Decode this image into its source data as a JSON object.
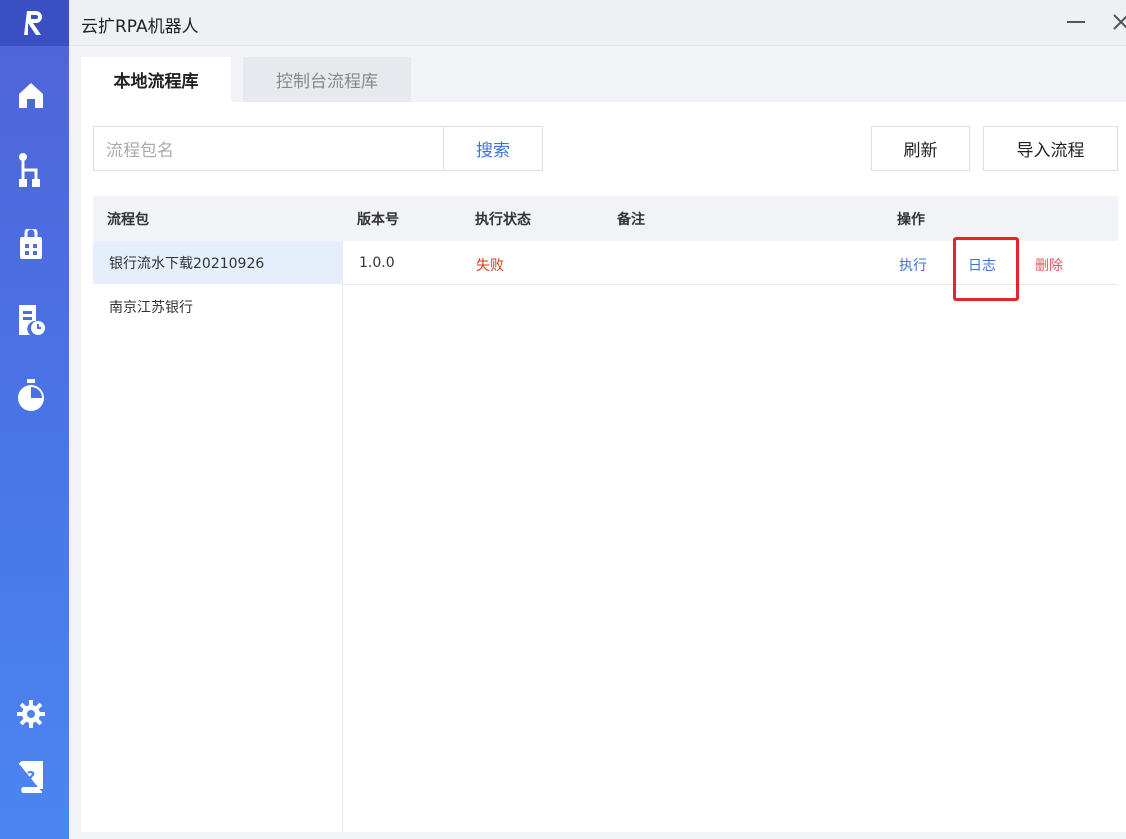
{
  "app": {
    "title": "云扩RPA机器人"
  },
  "tabs": [
    {
      "label": "本地流程库",
      "active": true
    },
    {
      "label": "控制台流程库",
      "active": false
    }
  ],
  "toolbar": {
    "search_placeholder": "流程包名",
    "search_label": "搜索",
    "refresh_label": "刷新",
    "import_label": "导入流程"
  },
  "table": {
    "headers": {
      "package": "流程包",
      "version": "版本号",
      "status": "执行状态",
      "notes": "备注",
      "actions": "操作"
    },
    "packages": [
      "银行流水下载20210926",
      "南京江苏银行"
    ],
    "rows": [
      {
        "version": "1.0.0",
        "status": "失败",
        "notes": "",
        "run": "执行",
        "log": "日志",
        "delete": "删除"
      }
    ]
  },
  "colors": {
    "accent": "#3b74db",
    "danger": "#e8232a",
    "status_fail": "#d93a1d",
    "sidebar": "#4a74e6"
  },
  "sidebar": {
    "items": [
      "home-icon",
      "flow-icon",
      "toolbox-icon",
      "schedule-doc-icon",
      "timer-icon"
    ],
    "bottom": [
      "gear-icon",
      "help-book-icon"
    ]
  }
}
